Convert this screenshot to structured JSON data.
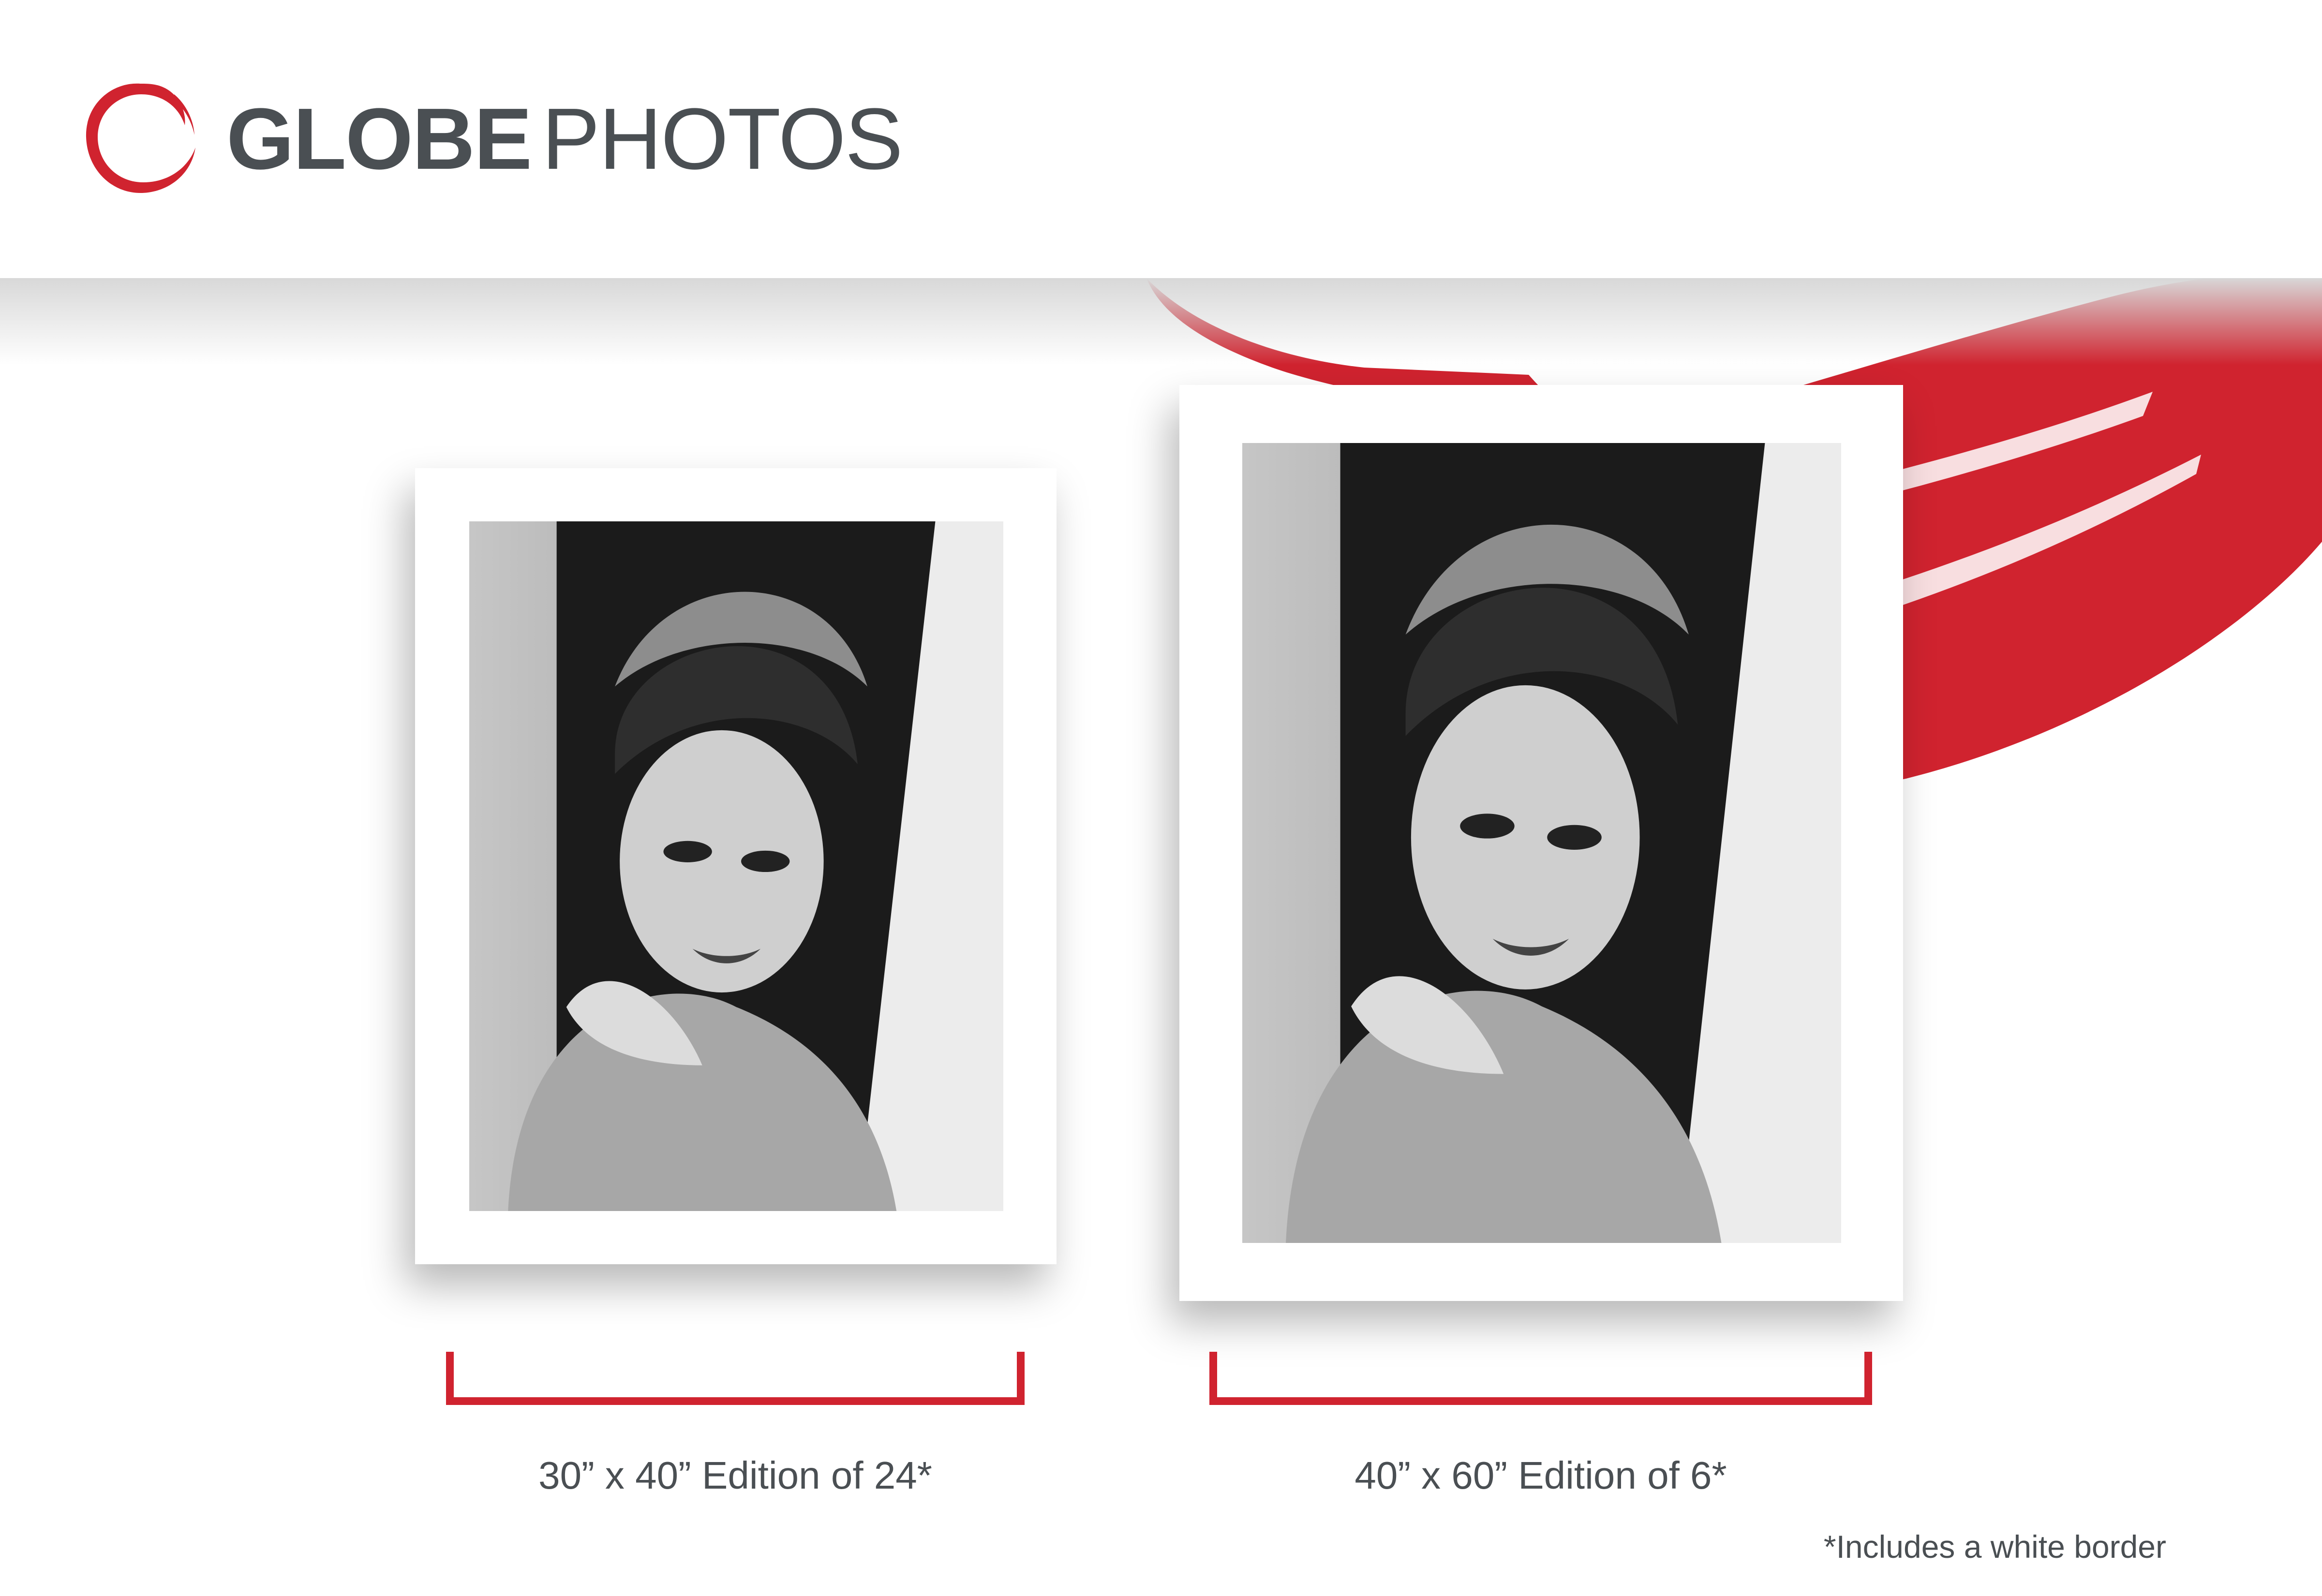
{
  "brand": {
    "name_bold": "GLOBE",
    "name_light": "PHOTOS",
    "logo_icon": "red-brush-circle-icon",
    "accent_color": "#d0232f",
    "text_color": "#4a4f53"
  },
  "prints": [
    {
      "size": "30” x 40” Edition of 24*"
    },
    {
      "size": "40” x 60” Edition of 6*"
    }
  ],
  "footnote": "*Includes a white border"
}
